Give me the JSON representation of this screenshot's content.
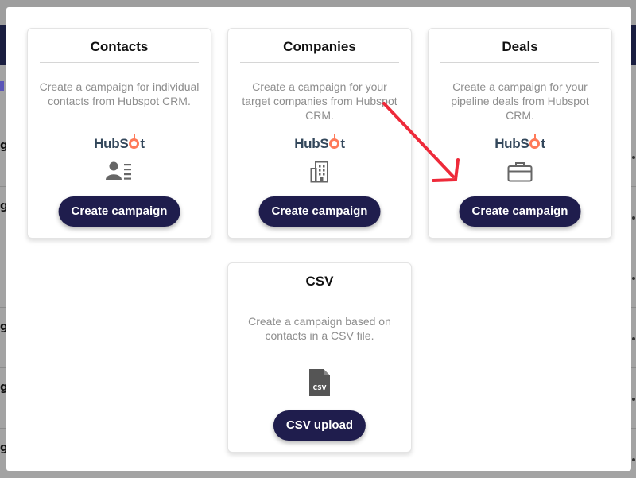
{
  "background": {
    "row_letters": [
      "g",
      "g",
      "g",
      "g",
      "g"
    ]
  },
  "cards": {
    "contacts": {
      "title": "Contacts",
      "description": "Create a campaign for individual contacts from Hubspot CRM.",
      "brand": "HubSpot",
      "icon": "contact-list-icon",
      "button": "Create campaign"
    },
    "companies": {
      "title": "Companies",
      "description": "Create a campaign for your target companies from Hubspot CRM.",
      "brand": "HubSpot",
      "icon": "building-icon",
      "button": "Create campaign"
    },
    "deals": {
      "title": "Deals",
      "description": "Create a campaign for your pipeline deals from Hubspot CRM.",
      "brand": "HubSpot",
      "icon": "briefcase-icon",
      "button": "Create campaign"
    },
    "csv": {
      "title": "CSV",
      "description": "Create a campaign based on contacts in a CSV file.",
      "file_badge": "CSV",
      "icon": "csv-file-icon",
      "button": "CSV upload"
    }
  },
  "colors": {
    "button_bg": "#1f1d4d",
    "hubspot_orange": "#ff7a59",
    "annotation_arrow": "#ee2a3a"
  }
}
